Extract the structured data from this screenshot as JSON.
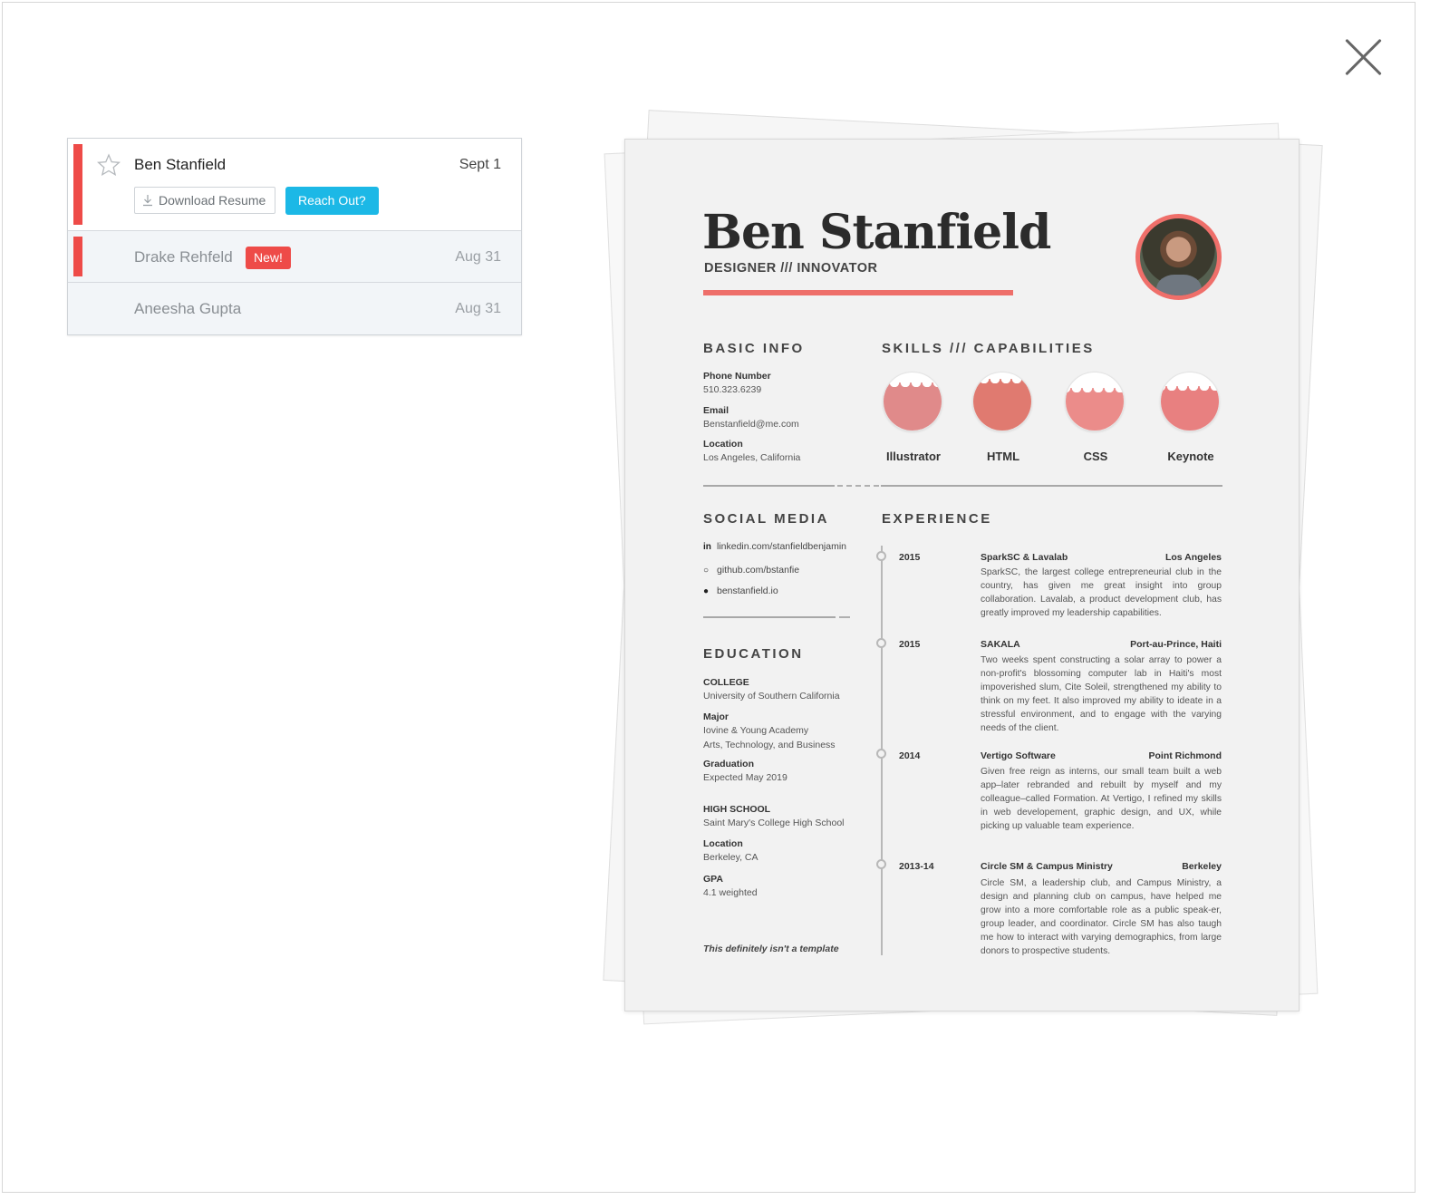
{
  "close_label": "Close",
  "candidates": [
    {
      "name": "Ben Stanfield",
      "date": "Sept 1",
      "download_label": "Download Resume",
      "reach_label": "Reach Out?"
    },
    {
      "name": "Drake Rehfeld",
      "badge": "New!",
      "date": "Aug 31"
    },
    {
      "name": "Aneesha Gupta",
      "date": "Aug 31"
    }
  ],
  "colors": {
    "accent_red": "#ee4b48",
    "accent_blue": "#1cb8e6",
    "resume_accent": "#ee6f6a"
  },
  "resume": {
    "name": "Ben Stanfield",
    "role": "DESIGNER /// INNOVATOR",
    "basic_info": {
      "heading": "BASIC INFO",
      "phone_label": "Phone Number",
      "phone": "510.323.6239",
      "email_label": "Email",
      "email": "Benstanfield@me.com",
      "location_label": "Location",
      "location": "Los Angeles, California"
    },
    "skills": {
      "heading": "SKILLS /// CAPABILITIES",
      "items": [
        {
          "label": "Illustrator",
          "level": 0.75,
          "color": "#e08a8a"
        },
        {
          "label": "HTML",
          "level": 0.82,
          "color": "#e07a70"
        },
        {
          "label": "CSS",
          "level": 0.66,
          "color": "#eb8c8a"
        },
        {
          "label": "Keynote",
          "level": 0.68,
          "color": "#e88080"
        }
      ]
    },
    "social": {
      "heading": "SOCIAL MEDIA",
      "items": [
        {
          "icon": "in",
          "text": "linkedin.com/stanfieldbenjamin"
        },
        {
          "icon": "○",
          "text": "github.com/bstanfie"
        },
        {
          "icon": "●",
          "text": "benstanfield.io"
        }
      ]
    },
    "education": {
      "heading": "EDUCATION",
      "college_label": "COLLEGE",
      "college": "University of Southern California",
      "major_label": "Major",
      "major_1": "Iovine & Young Academy",
      "major_2": "Arts, Technology, and Business",
      "graduation_label": "Graduation",
      "graduation": "Expected May 2019",
      "highschool_label": "HIGH SCHOOL",
      "highschool": "Saint Mary's College High School",
      "hs_location_label": "Location",
      "hs_location": "Berkeley, CA",
      "gpa_label": "GPA",
      "gpa": "4.1 weighted"
    },
    "experience": {
      "heading": "EXPERIENCE",
      "items": [
        {
          "year": "2015",
          "org": "SparkSC & Lavalab",
          "location": "Los Angeles",
          "desc": "SparkSC, the largest college entrepreneurial club in the country, has given me great insight into group collaboration. Lavalab, a product development club, has greatly improved my leadership capabilities."
        },
        {
          "year": "2015",
          "org": "SAKALA",
          "location": "Port-au-Prince, Haiti",
          "desc": "Two weeks spent constructing a solar array to power a non-profit's blossoming computer lab in Haiti's most impoverished slum, Cite Soleil, strengthened my ability to think on my feet. It also improved my ability to ideate in a stressful environment, and to engage with the varying needs of the client."
        },
        {
          "year": "2014",
          "org": "Vertigo Software",
          "location": "Point Richmond",
          "desc": "Given free reign as interns, our small team built a web app–later rebranded and rebuilt by myself and my colleague–called Formation. At Vertigo, I refined my skills in web developement, graphic design, and UX, while picking up valuable team experience."
        },
        {
          "year": "2013-14",
          "org": "Circle SM & Campus Ministry",
          "location": "Berkeley",
          "desc": "Circle SM, a leadership club, and Campus Ministry, a design and planning club on campus, have helped me grow into a more comfortable role as a public speak-er, group leader, and coordinator. Circle SM has also taugh me how to interact with varying demographics, from large donors to prospective students."
        }
      ]
    },
    "footnote": "This definitely isn't a template"
  }
}
